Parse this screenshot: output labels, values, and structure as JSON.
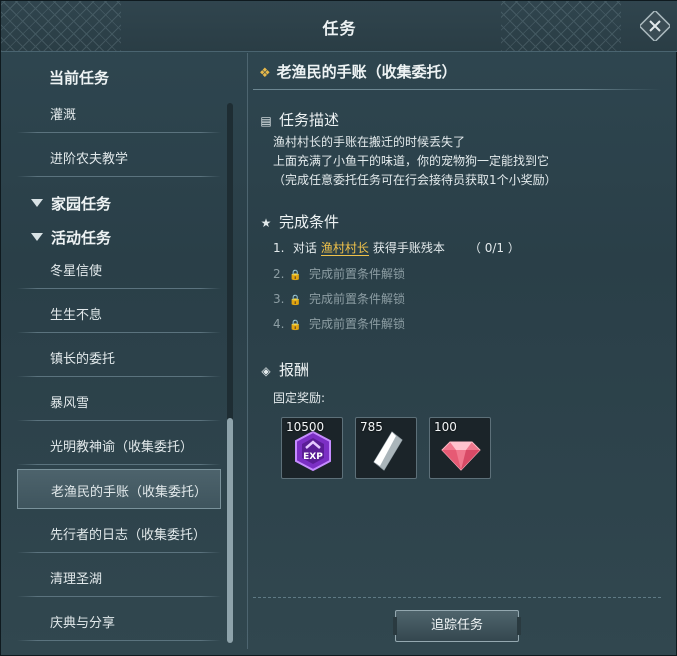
{
  "window": {
    "title": "任务"
  },
  "sidebar": {
    "current_header": "当前任务",
    "current_items": [
      {
        "label": "灌溉"
      },
      {
        "label": "进阶农夫教学"
      }
    ],
    "home_header": "家园任务",
    "event_header": "活动任务",
    "event_items": [
      {
        "label": "冬星信使"
      },
      {
        "label": "生生不息"
      },
      {
        "label": "镇长的委托"
      },
      {
        "label": "暴风雪"
      },
      {
        "label": "光明教神谕（收集委托）"
      },
      {
        "label": "老渔民的手账（收集委托）"
      },
      {
        "label": "先行者的日志（收集委托）"
      },
      {
        "label": "清理圣湖"
      },
      {
        "label": "庆典与分享"
      }
    ],
    "selected_index": 5
  },
  "quest": {
    "title": "老渔民的手账（收集委托）",
    "description_header": "任务描述",
    "description_lines": [
      "渔村村长的手账在搬迁的时候丢失了",
      "上面充满了小鱼干的味道，你的宠物狗一定能找到它",
      "（完成任意委托任务可在行会接待员获取1个小奖励）"
    ],
    "conditions_header": "完成条件",
    "conditions": [
      {
        "num": "1.",
        "prefix": "对话",
        "npc": "渔村村长",
        "suffix": "获得手账残本",
        "progress": "（ 0/1 ）"
      },
      {
        "num": "2.",
        "text": "完成前置条件解锁"
      },
      {
        "num": "3.",
        "text": "完成前置条件解锁"
      },
      {
        "num": "4.",
        "text": "完成前置条件解锁"
      }
    ],
    "rewards_header": "报酬",
    "fixed_rewards_label": "固定奖励:",
    "rewards": [
      {
        "icon": "exp-badge-icon",
        "qty": "10500",
        "color": "#8a3fd0"
      },
      {
        "icon": "silver-crystal-icon",
        "qty": "785",
        "color": "#d9dee2"
      },
      {
        "icon": "pink-gem-icon",
        "qty": "100",
        "color": "#f06f86"
      }
    ],
    "track_button": "追踪任务"
  },
  "colors": {
    "accent": "#f0c24a",
    "panel": "#2f4751"
  }
}
